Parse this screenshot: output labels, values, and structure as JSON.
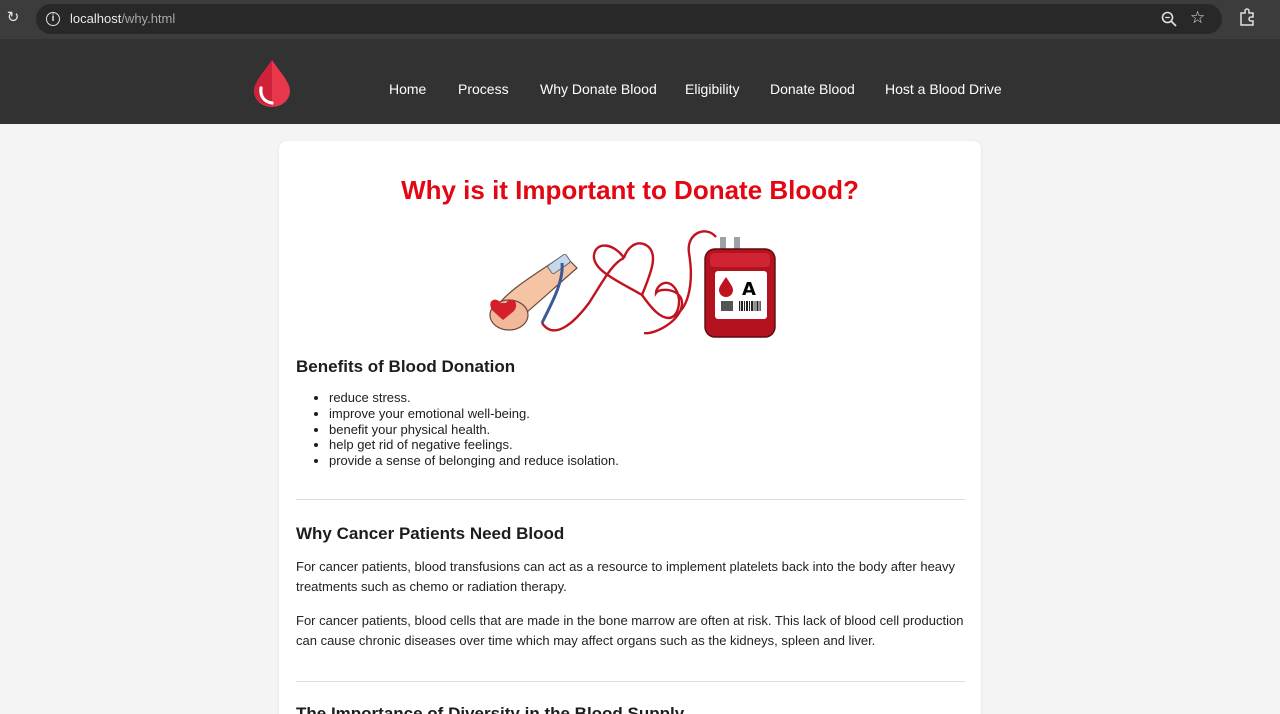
{
  "browser": {
    "url_host": "localhost",
    "url_path": "/why.html",
    "reload_icon": "reload-icon",
    "info_icon": "info-icon",
    "zoom_icon": "zoom-icon",
    "star_icon": "star-icon",
    "extensions_icon": "extensions-icon"
  },
  "header": {
    "logo": "blood-drop-logo",
    "nav": [
      "Home",
      "Process",
      "Why Donate Blood",
      "Eligibility",
      "Donate Blood",
      "Host a Blood Drive"
    ]
  },
  "main": {
    "title": "Why is it Important to Donate Blood?",
    "hero_bag_label": "A",
    "benefits_heading": "Benefits of Blood Donation",
    "benefits": [
      "reduce stress.",
      "improve your emotional well-being.",
      "benefit your physical health.",
      "help get rid of negative feelings.",
      "provide a sense of belonging and reduce isolation."
    ],
    "cancer_heading": "Why Cancer Patients Need Blood",
    "cancer_paragraphs": [
      "For cancer patients, blood transfusions can act as a resource to implement platelets back into the body after heavy treatments such as chemo or radiation therapy.",
      "For cancer patients, blood cells that are made in the bone marrow are often at risk. This lack of blood cell production can cause chronic diseases over time which may affect organs such as the kidneys, spleen and liver."
    ],
    "diversity_heading": "The Importance of Diversity in the Blood Supply"
  },
  "colors": {
    "accent_red": "#e30613",
    "header_bg": "#323232",
    "page_bg": "#f4f4f5"
  }
}
